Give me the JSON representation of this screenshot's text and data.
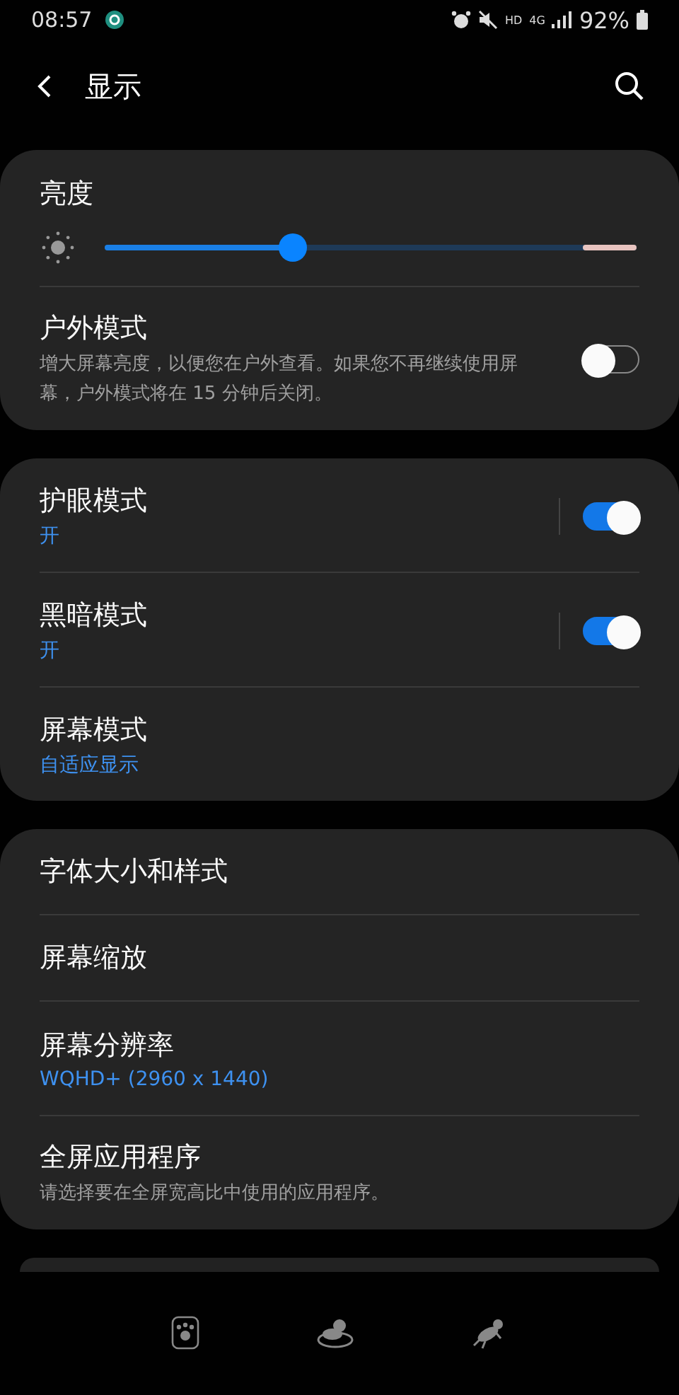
{
  "status_bar": {
    "time": "08:57",
    "network": "HD",
    "mobile": "4G",
    "battery": "92%"
  },
  "header": {
    "title": "显示"
  },
  "brightness": {
    "title": "亮度",
    "level": 0.355
  },
  "sections": [
    {
      "items": [
        {
          "kind": "switch",
          "title": "户外模式",
          "description": "增大屏幕亮度，以便您在户外查看。如果您不再继续使用屏幕，户外模式将在 15 分钟后关闭。",
          "on": false
        }
      ]
    },
    {
      "items": [
        {
          "kind": "switch",
          "title": "护眼模式",
          "value": "开",
          "on": true
        },
        {
          "kind": "switch",
          "title": "黑暗模式",
          "value": "开",
          "on": true
        },
        {
          "kind": "link",
          "title": "屏幕模式",
          "value": "自适应显示"
        }
      ]
    },
    {
      "items": [
        {
          "kind": "link",
          "title": "字体大小和样式"
        },
        {
          "kind": "link",
          "title": "屏幕缩放"
        },
        {
          "kind": "link",
          "title": "屏幕分辨率",
          "value": "WQHD+ (2960 x 1440)"
        },
        {
          "kind": "link",
          "title": "全屏应用程序",
          "description": "请选择要在全屏宽高比中使用的应用程序。"
        }
      ]
    }
  ]
}
